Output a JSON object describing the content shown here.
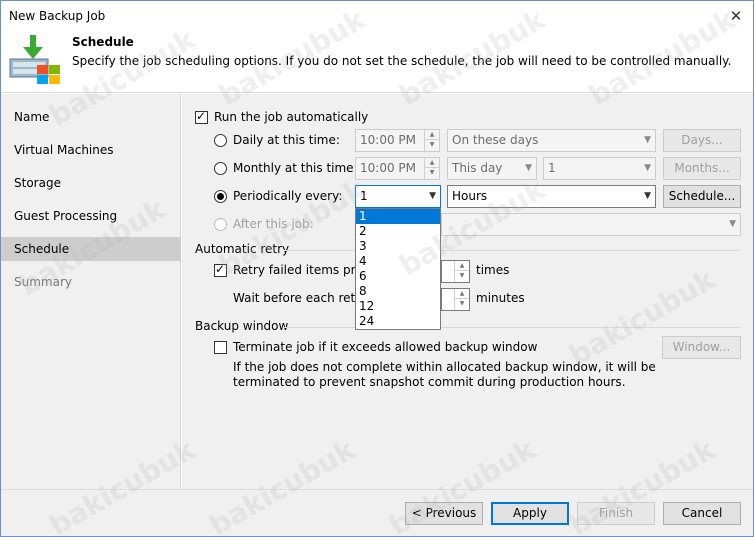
{
  "window": {
    "title": "New Backup Job",
    "close_glyph": "✕"
  },
  "header": {
    "title": "Schedule",
    "description": "Specify the job scheduling options. If you do not set the schedule, the job will need to be controlled manually.",
    "icon": "backup-job-icon"
  },
  "sidebar": {
    "items": [
      {
        "label": "Name",
        "state": "normal"
      },
      {
        "label": "Virtual Machines",
        "state": "normal"
      },
      {
        "label": "Storage",
        "state": "normal"
      },
      {
        "label": "Guest Processing",
        "state": "normal"
      },
      {
        "label": "Schedule",
        "state": "active"
      },
      {
        "label": "Summary",
        "state": "disabled"
      }
    ]
  },
  "schedule": {
    "run_auto_label": "Run the job automatically",
    "run_auto_checked": true,
    "daily": {
      "label": "Daily at this time:",
      "time": "10:00 PM",
      "days_value": "On these days",
      "button": "Days..."
    },
    "monthly": {
      "label": "Monthly at this time:",
      "time": "10:00 PM",
      "day_value": "This day",
      "number_value": "1",
      "button": "Months..."
    },
    "periodic": {
      "label": "Periodically every:",
      "value": "1",
      "unit": "Hours",
      "button": "Schedule...",
      "selected": true
    },
    "after": {
      "label": "After this job:"
    },
    "dropdown_options": [
      "1",
      "2",
      "3",
      "4",
      "6",
      "8",
      "12",
      "24"
    ],
    "dropdown_selected": "1"
  },
  "retry": {
    "group_label": "Automatic retry",
    "retry_label": "Retry failed items proce",
    "retry_checked": true,
    "retry_suffix": "times",
    "wait_label": "Wait before each retry a",
    "wait_suffix": "minutes"
  },
  "backup_window": {
    "group_label": "Backup window",
    "terminate_label": "Terminate job if it exceeds allowed backup window",
    "terminate_checked": false,
    "window_button": "Window...",
    "note_line1": "If the job does not complete within allocated backup window, it will be",
    "note_line2": "terminated to prevent snapshot commit during production hours."
  },
  "footer": {
    "previous": "< Previous",
    "apply": "Apply",
    "finish": "Finish",
    "cancel": "Cancel"
  },
  "watermark": "bakicubuk",
  "colors": {
    "accent": "#0078d7",
    "icon_green": "#3aaa35"
  }
}
